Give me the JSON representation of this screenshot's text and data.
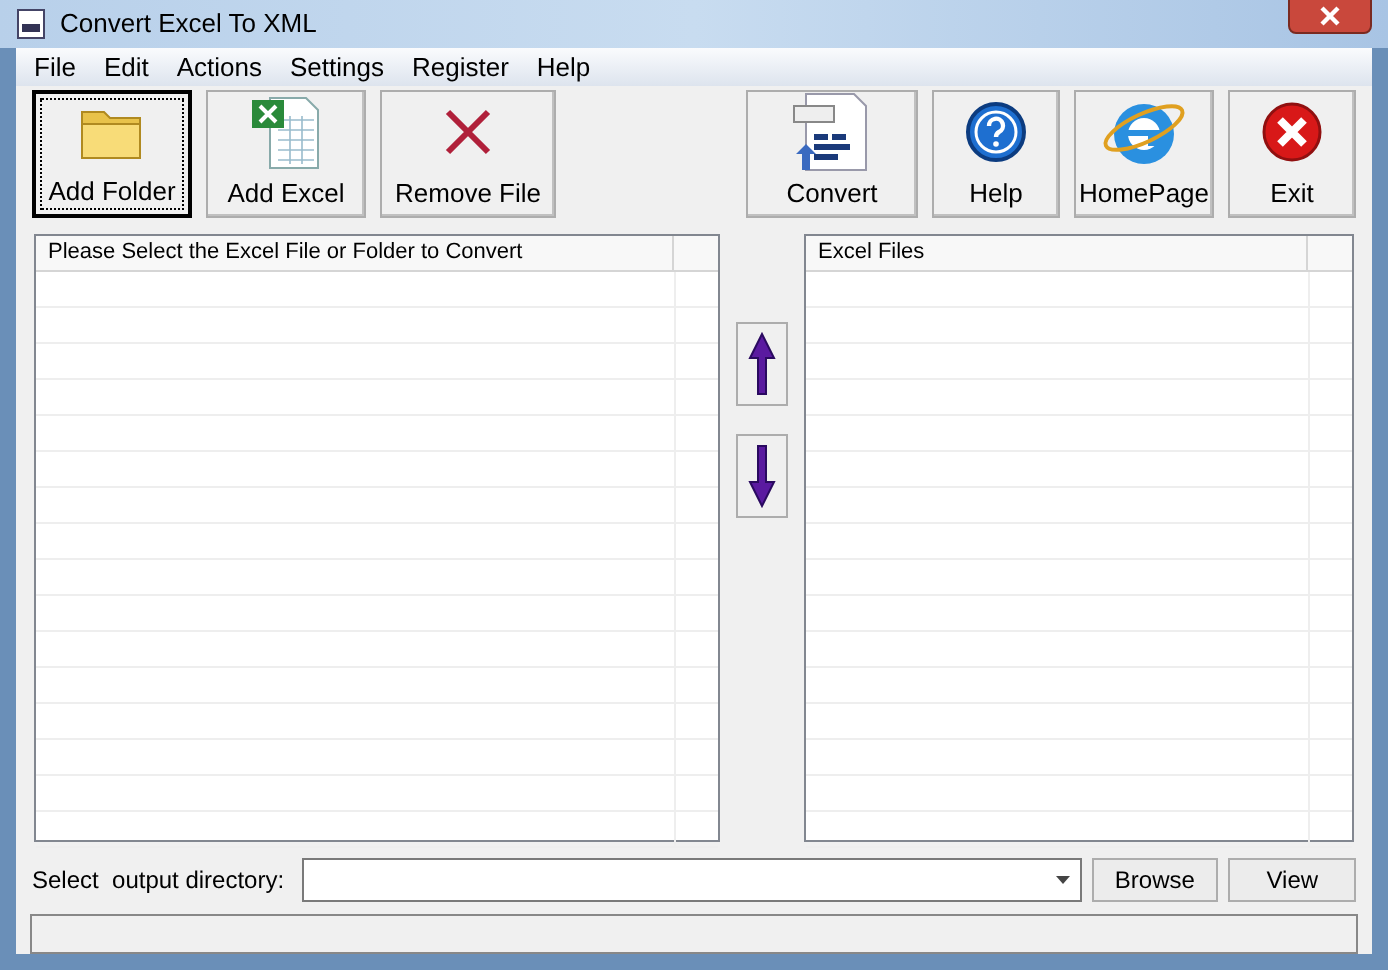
{
  "window": {
    "title": "Convert Excel To XML"
  },
  "menu": [
    "File",
    "Edit",
    "Actions",
    "Settings",
    "Register",
    "Help"
  ],
  "toolbar_left": [
    {
      "kind": "folder",
      "label": "Add Folder",
      "selected": true
    },
    {
      "kind": "excel",
      "label": "Add Excel",
      "selected": false
    },
    {
      "kind": "remove",
      "label": "Remove File",
      "selected": false
    }
  ],
  "toolbar_right": [
    {
      "kind": "xml",
      "label": "Convert",
      "selected": false
    },
    {
      "kind": "help",
      "label": "Help",
      "selected": false
    },
    {
      "kind": "globe",
      "label": "HomePage",
      "selected": false
    },
    {
      "kind": "exit",
      "label": "Exit",
      "selected": false
    }
  ],
  "source_list": {
    "columns": [
      "Please Select the Excel File or Folder to Convert"
    ]
  },
  "target_list": {
    "columns": [
      "Excel Files"
    ]
  },
  "output": {
    "label": "Select  output directory:",
    "buttons": [
      "Browse",
      "View"
    ]
  }
}
